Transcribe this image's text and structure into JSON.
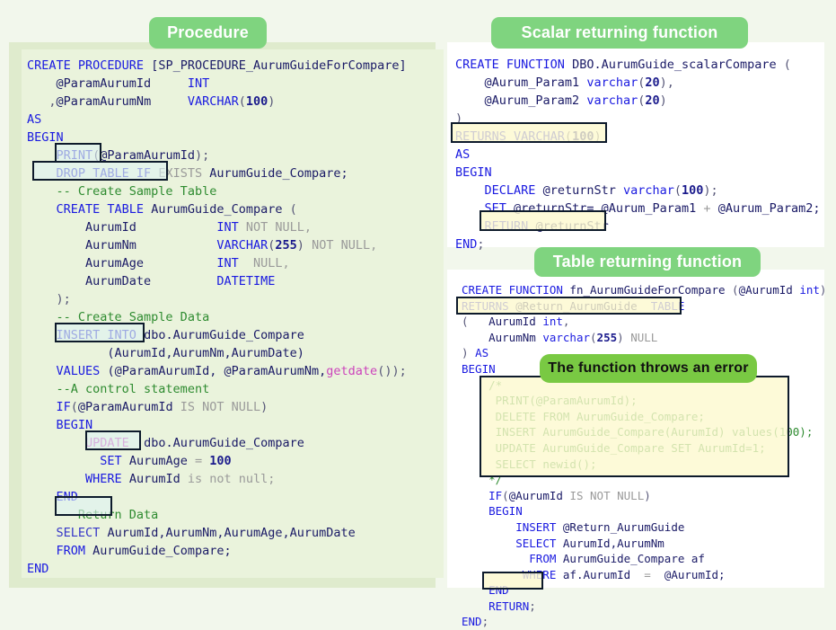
{
  "page": {
    "background": "#f2f7ec",
    "pill_color": "#7fd47f",
    "error_pill_color": "#79c943"
  },
  "panels": {
    "procedure": {
      "title": "Procedure",
      "code": "CREATE PROCEDURE [SP_PROCEDURE_AurumGuideForCompare]\n    @ParamAurumId     INT\n   ,@ParamAurumNm     VARCHAR(100)\nAS\nBEGIN\n    PRINT(@ParamAurumId);\n    DROP TABLE IF EXISTS AurumGuide_Compare;\n    -- Create Sample Table\n    CREATE TABLE AurumGuide_Compare (\n        AurumId           INT NOT NULL,\n        AurumNm           VARCHAR(255) NOT NULL,\n        AurumAge          INT  NULL,\n        AurumDate         DATETIME\n    );\n    -- Create Sample Data\n    INSERT INTO dbo.AurumGuide_Compare\n           (AurumId,AurumNm,AurumDate)\n    VALUES (@ParamAurumId, @ParamAurumNm,getdate());\n    --A control statement\n    IF(@ParamAurumId IS NOT NULL)\n    BEGIN\n        UPDATE  dbo.AurumGuide_Compare\n          SET AurumAge = 100\n        WHERE AurumId is not null;\n    END\n    -- Return Data\n    SELECT AurumId,AurumNm,AurumAge,AurumDate\n    FROM AurumGuide_Compare;\nEND",
      "highlights": [
        {
          "label": "PRINT",
          "style": "cyan"
        },
        {
          "label": "DROP TABLE IF",
          "style": "cyan"
        },
        {
          "label": "INSERT INTO",
          "style": "cyan"
        },
        {
          "label": "UPDATE",
          "style": "cyan"
        },
        {
          "label": "SELECT",
          "style": "cyan"
        }
      ]
    },
    "scalar_function": {
      "title": "Scalar returning function",
      "code": "CREATE FUNCTION DBO.AurumGuide_scalarCompare (\n    @Aurum_Param1 varchar(20),\n    @Aurum_Param2 varchar(20)\n)\nRETURNS VARCHAR(100)\nAS\nBEGIN\n    DECLARE @returnStr varchar(100);\n    SET @returnStr= @Aurum_Param1 + @Aurum_Param2;\n    RETURN @returnStr\nEND;",
      "highlights": [
        {
          "label": "RETURNS VARCHAR(100)",
          "style": "yellow"
        },
        {
          "label": "RETURN @returnStr",
          "style": "yellow"
        }
      ]
    },
    "table_function": {
      "title": "Table returning function",
      "error_badge": "The function throws an error",
      "code": "CREATE FUNCTION fn_AurumGuideForCompare (@AurumId int)\nRETURNS @Return_AurumGuide  TABLE\n(   AurumId int,\n    AurumNm varchar(255) NULL\n) AS\nBEGIN\n    /*\n     PRINT(@ParamAurumId);\n     DELETE FROM AurumGuide_Compare;\n     INSERT AurumGuide_Compare(AurumId) values(100);\n     UPDATE AurumGuide_Compare SET AurumId=1;\n     SELECT newid();\n    */\n    IF(@AurumId IS NOT NULL)\n    BEGIN\n        INSERT @Return_AurumGuide\n        SELECT AurumId,AurumNm\n          FROM AurumGuide_Compare af\n         WHERE af.AurumId  =  @AurumId;\n    END\n    RETURN;\nEND;",
      "highlights": [
        {
          "label": "RETURNS @Return_AurumGuide TABLE",
          "style": "yellow"
        },
        {
          "label": "comment-block",
          "style": "yellow"
        },
        {
          "label": "RETURN;",
          "style": "yellow"
        }
      ]
    }
  }
}
